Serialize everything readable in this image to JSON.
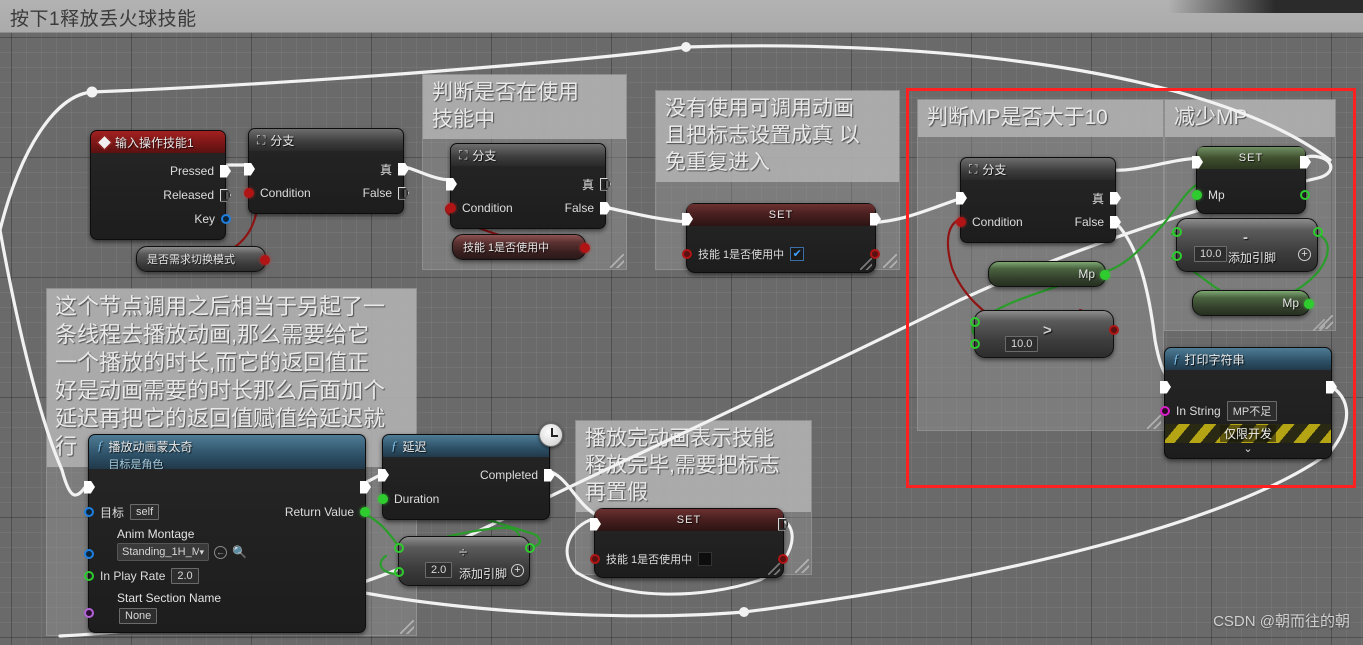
{
  "titlebar": {
    "title": "按下1释放丢火球技能"
  },
  "watermark": "CSDN @朝而往的朝",
  "comments": [
    {
      "id": "c_using_skill",
      "text": "判断是否在使用\n技能中"
    },
    {
      "id": "c_no_anim",
      "text": "没有使用可调用动画\n且把标志设置成真 以\n免重复进入"
    },
    {
      "id": "c_montage",
      "text": "这个节点调用之后相当于另起了一\n条线程去播放动画,那么需要给它\n一个播放的时长,而它的返回值正\n好是动画需要的时长那么后面加个\n延迟再把它的返回值赋值给延迟就\n行"
    },
    {
      "id": "c_done",
      "text": "播放完动画表示技能\n释放完毕,需要把标志\n再置假"
    },
    {
      "id": "c_mp_check",
      "text": "判断MP是否大于10"
    },
    {
      "id": "c_mp_dec",
      "text": "减少MP"
    }
  ],
  "nodes": {
    "input_action": {
      "title": "输入操作技能1",
      "icon": "diamond-icon",
      "pins": [
        {
          "label": "Pressed",
          "type": "exec-filled"
        },
        {
          "label": "Released",
          "type": "exec-hollow"
        },
        {
          "label": "Key",
          "type": "data-blue"
        }
      ]
    },
    "branch1": {
      "title": "分支",
      "icon": "branch-icon",
      "in_exec": "",
      "condition_label": "Condition",
      "true_label": "真",
      "false_label": "False"
    },
    "branch2": {
      "title": "分支",
      "icon": "branch-icon",
      "condition_label": "Condition",
      "true_label": "真",
      "false_label": "False"
    },
    "branch3": {
      "title": "分支",
      "icon": "branch-icon",
      "condition_label": "Condition",
      "true_label": "真",
      "false_label": "False"
    },
    "var_switch_mode": {
      "label": "是否需求切换模式"
    },
    "var_skill1_inuse_get": {
      "label": "技能 1是否使用中"
    },
    "set_skill1_true": {
      "title": "SET",
      "var_label": "技能 1是否使用中",
      "value": true
    },
    "set_skill1_false": {
      "title": "SET",
      "var_label": "技能 1是否使用中",
      "value": false
    },
    "var_mp_get1": {
      "label": "Mp"
    },
    "var_mp_get2": {
      "label": "Mp"
    },
    "greater_node": {
      "operator": ">",
      "b_value": "10.0"
    },
    "set_mp": {
      "title": "SET",
      "var_label": "Mp"
    },
    "subtract_node": {
      "operator": "-",
      "b_value": "10.0",
      "add_pin_label": "添加引脚"
    },
    "divide_node": {
      "operator": "÷",
      "b_value": "2.0",
      "add_pin_label": "添加引脚"
    },
    "play_anim_montage": {
      "title": "播放动画蒙太奇",
      "subtitle": "目标是角色",
      "target_label": "目标",
      "target_value": "self",
      "anim_montage_label": "Anim Montage",
      "anim_montage_value": "Standing_1H_M",
      "in_play_rate_label": "In Play Rate",
      "in_play_rate_value": "2.0",
      "start_section_label": "Start Section Name",
      "start_section_value": "None",
      "return_value_label": "Return Value"
    },
    "delay": {
      "title": "延迟",
      "completed_label": "Completed",
      "duration_label": "Duration",
      "icon": "clock-icon"
    },
    "print_string": {
      "title": "打印字符串",
      "in_string_label": "In String",
      "in_string_value": "MP不足",
      "dev_only_label": "仅限开发",
      "expand_icon": "chevron-down-icon"
    }
  },
  "selection": {
    "color": "#ff2020"
  }
}
